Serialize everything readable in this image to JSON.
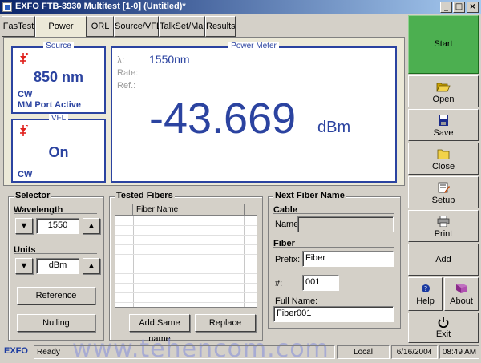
{
  "window": {
    "title": "EXFO FTB-3930 Multitest [1-0] (Untitled)*"
  },
  "tabs": [
    {
      "label": "FasTest",
      "active": false
    },
    {
      "label": "Power Meter",
      "active": true
    },
    {
      "label": "ORL",
      "active": false
    },
    {
      "label": "Source/VFL",
      "active": false
    },
    {
      "label": "TalkSet/Mail",
      "active": false
    },
    {
      "label": "Results",
      "active": false
    }
  ],
  "source": {
    "title": "Source",
    "wavelength": "850 nm",
    "mode": "CW",
    "port": "MM Port Active"
  },
  "vfl": {
    "title": "VFL",
    "state": "On",
    "mode": "CW"
  },
  "power_meter": {
    "title": "Power Meter",
    "lambda_symbol": "λ:",
    "wavelength": "1550nm",
    "rate_label": "Rate:",
    "ref_label": "Ref.:",
    "value": "-43.669",
    "unit": "dBm"
  },
  "selector": {
    "title": "Selector",
    "wavelength_label": "Wavelength",
    "wavelength_value": "1550",
    "units_label": "Units",
    "units_value": "dBm",
    "reference_label": "Reference",
    "nulling_label": "Nulling"
  },
  "tested_fibers": {
    "title": "Tested Fibers",
    "column": "Fiber Name",
    "add_same_name_label": "Add Same name",
    "replace_label": "Replace"
  },
  "next_fiber": {
    "title": "Next Fiber Name",
    "cable_label": "Cable",
    "name_label": "Name:",
    "name_value": "",
    "fiber_label": "Fiber",
    "prefix_label": "Prefix:",
    "prefix_value": "Fiber",
    "number_label": "#:",
    "number_value": "001",
    "fullname_label": "Full Name:",
    "fullname_value": "Fiber001"
  },
  "right_buttons": {
    "start": "Start",
    "open": "Open",
    "save": "Save",
    "close": "Close",
    "setup": "Setup",
    "print": "Print",
    "add": "Add",
    "help": "Help",
    "about": "About",
    "exit": "Exit"
  },
  "statusbar": {
    "brand": "EXFO",
    "status": "Ready",
    "location": "Local",
    "date": "6/16/2004",
    "time": "08:49 AM"
  },
  "watermark": "www.tehencom.com",
  "colors": {
    "accent_blue": "#2b43a0",
    "start_green": "#4caf50",
    "red_icon": "#e0201c"
  }
}
